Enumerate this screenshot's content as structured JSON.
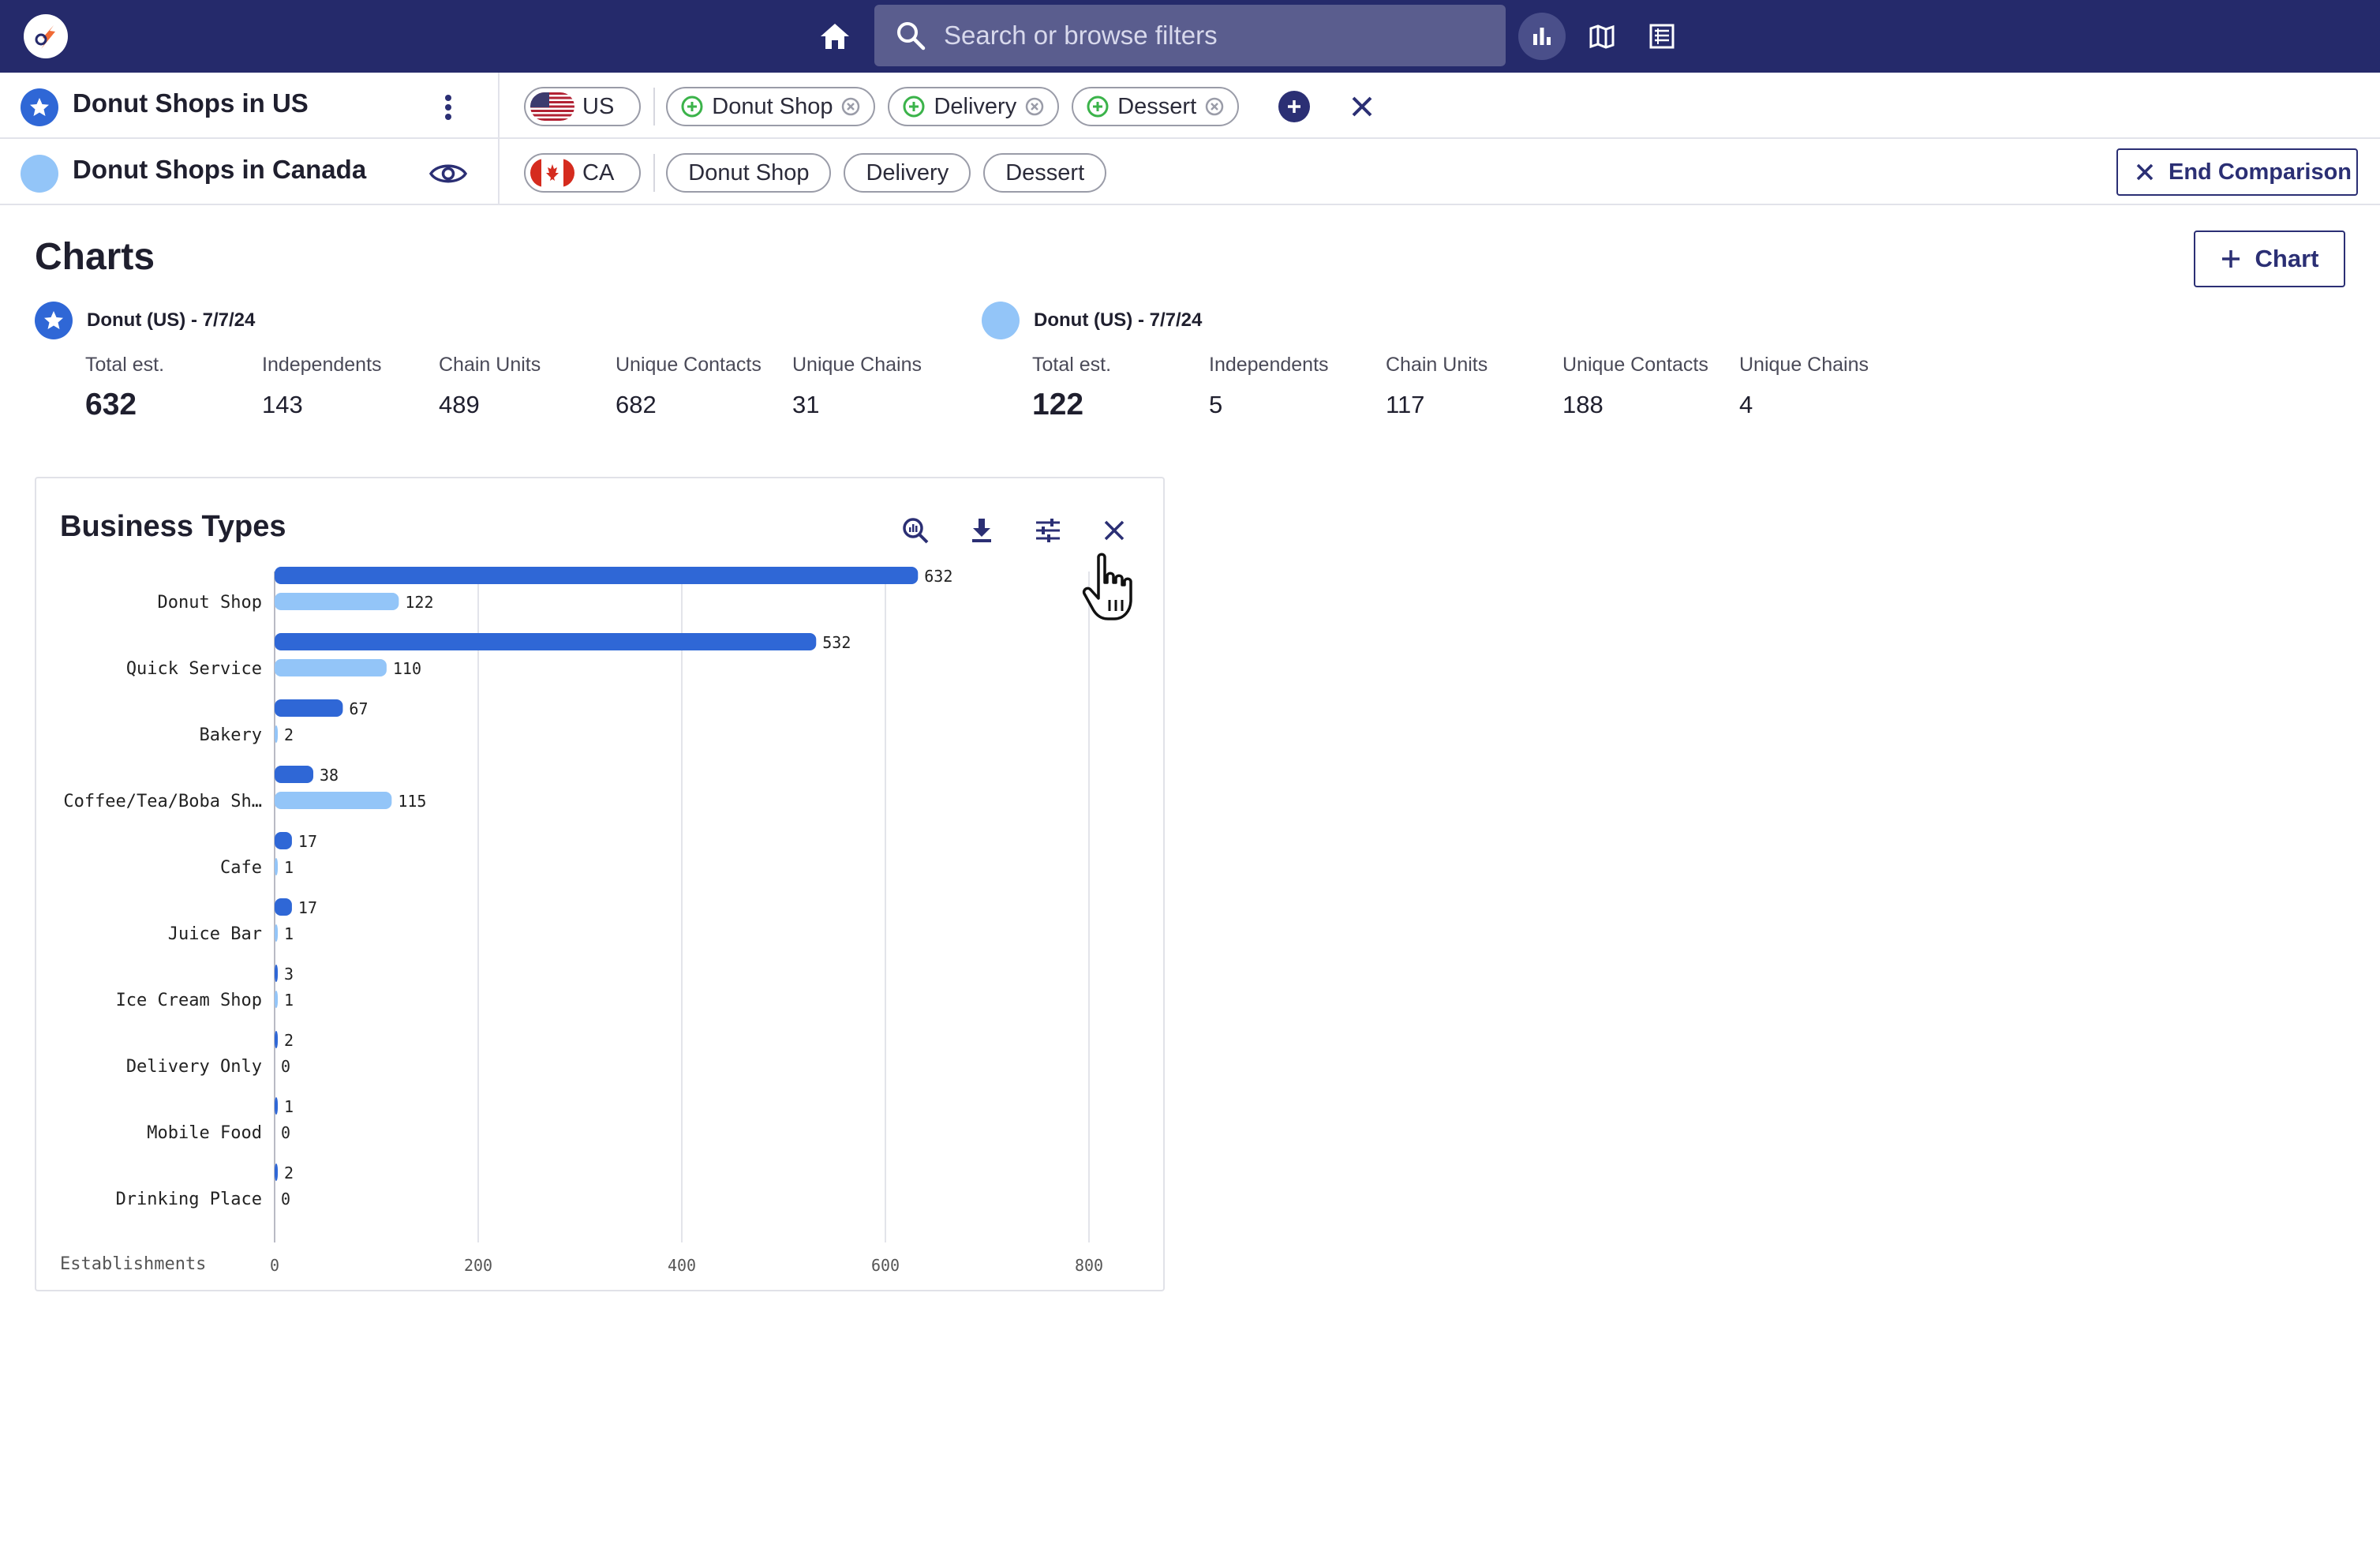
{
  "topbar": {
    "logo_icon": "rocket-logo-icon",
    "search_placeholder": "Search or browse filters",
    "views": [
      "chart-view-icon",
      "map-view-icon",
      "table-view-icon"
    ]
  },
  "comparison": {
    "primary": {
      "name": "Donut Shops in US",
      "country": "US",
      "filters": [
        "Donut Shop",
        "Delivery",
        "Dessert"
      ]
    },
    "secondary": {
      "name": "Donut Shops in Canada",
      "country": "CA",
      "filters": [
        "Donut Shop",
        "Delivery",
        "Dessert"
      ],
      "end_label": "End Comparison"
    }
  },
  "charts": {
    "title": "Charts",
    "add_label": "Chart",
    "summaries": [
      {
        "title": "Donut (US) - 7/7/24",
        "stats": [
          {
            "label": "Total est.",
            "value": "632"
          },
          {
            "label": "Independents",
            "value": "143"
          },
          {
            "label": "Chain Units",
            "value": "489"
          },
          {
            "label": "Unique Contacts",
            "value": "682"
          },
          {
            "label": "Unique Chains",
            "value": "31"
          }
        ]
      },
      {
        "title": "Donut (US) - 7/7/24",
        "stats": [
          {
            "label": "Total est.",
            "value": "122"
          },
          {
            "label": "Independents",
            "value": "5"
          },
          {
            "label": "Chain Units",
            "value": "117"
          },
          {
            "label": "Unique Contacts",
            "value": "188"
          },
          {
            "label": "Unique Chains",
            "value": "4"
          }
        ]
      }
    ]
  },
  "card": {
    "title": "Business Types"
  },
  "colors": {
    "primary_series": "#2f67d6",
    "secondary_series": "#93c5f8",
    "navy": "#252a6b"
  },
  "chart_data": {
    "type": "bar",
    "orientation": "horizontal",
    "title": "Business Types",
    "xlabel": "Establishments",
    "ylabel": "",
    "xlim": [
      0,
      800
    ],
    "xticks": [
      0,
      200,
      400,
      600,
      800
    ],
    "grid": true,
    "categories": [
      "Donut Shop",
      "Quick Service",
      "Bakery",
      "Coffee/Tea/Boba Sh…",
      "Cafe",
      "Juice Bar",
      "Ice Cream Shop",
      "Delivery Only",
      "Mobile Food",
      "Drinking Place"
    ],
    "series": [
      {
        "values": [
          632,
          532,
          67,
          38,
          17,
          17,
          3,
          2,
          1,
          2
        ]
      },
      {
        "values": [
          122,
          110,
          2,
          115,
          1,
          1,
          1,
          0,
          0,
          0
        ]
      }
    ]
  }
}
